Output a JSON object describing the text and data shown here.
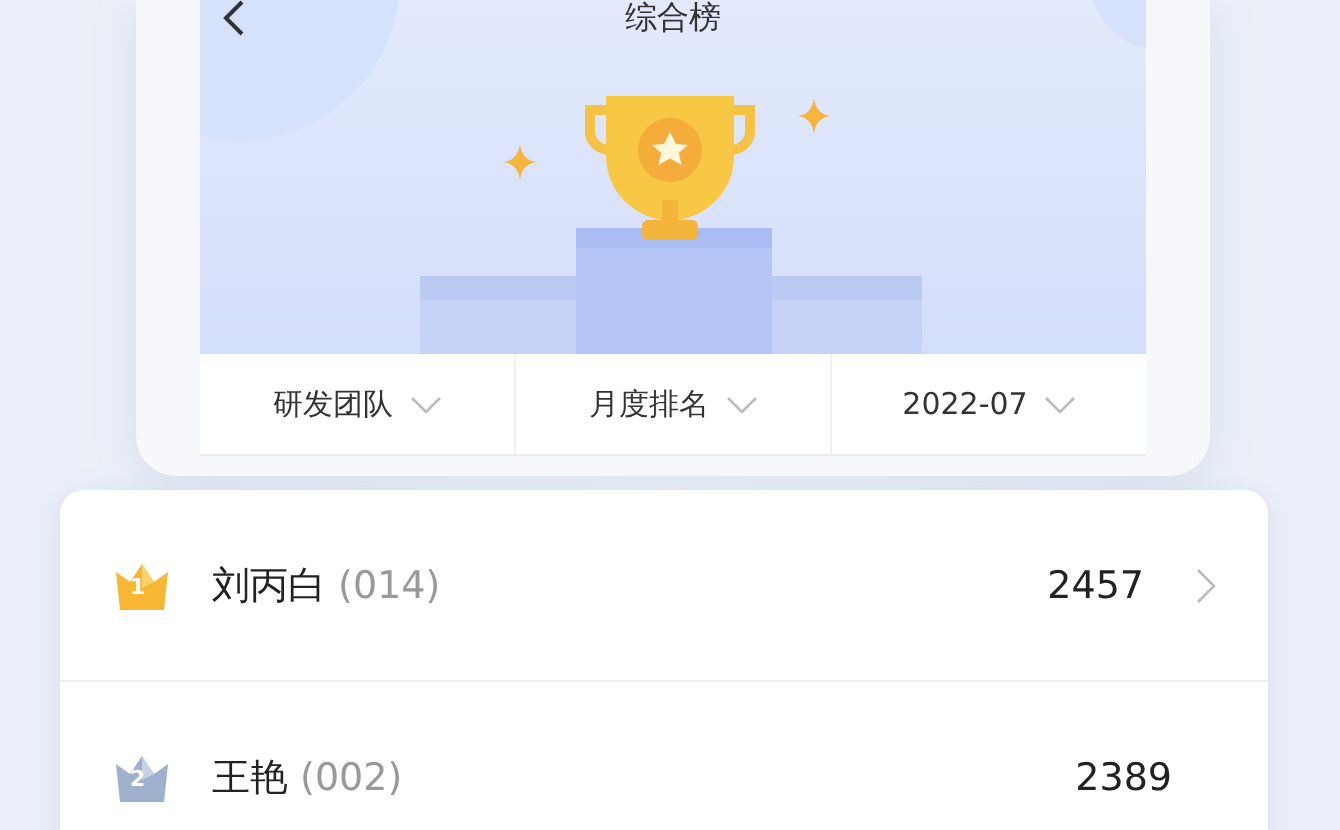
{
  "header": {
    "title": "综合榜"
  },
  "filters": [
    {
      "label": "研发团队"
    },
    {
      "label": "月度排名"
    },
    {
      "label": "2022-07"
    }
  ],
  "ranking": [
    {
      "kind": "gold",
      "rank": "1",
      "name": "刘丙白",
      "code": "(014)",
      "score": "2457",
      "chevron": true
    },
    {
      "kind": "silver",
      "rank": "2",
      "name": "王艳",
      "code": "(002)",
      "score": "2389",
      "chevron": false
    }
  ]
}
